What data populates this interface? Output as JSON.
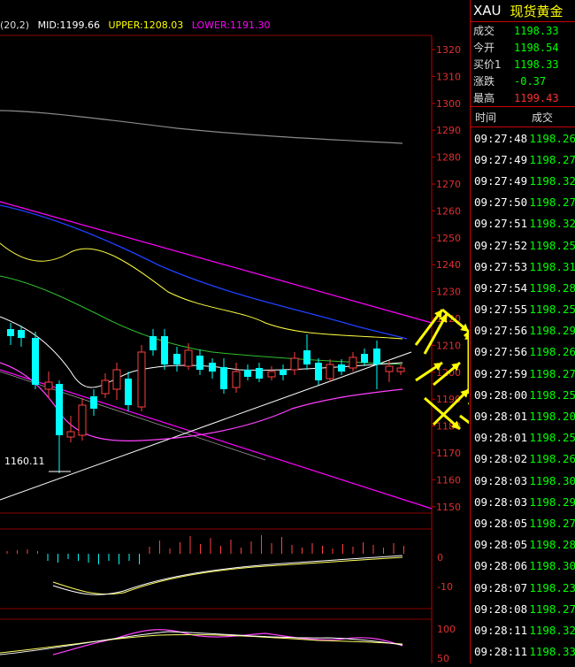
{
  "indicator": {
    "params": "(20,2)",
    "mid": "MID:1199.66",
    "upper": "UPPER:1208.03",
    "lower": "LOWER:1191.30",
    "colors": {
      "params": "#dddddd",
      "mid": "#ffffff",
      "upper": "#ffff00",
      "lower": "#ff00ff"
    }
  },
  "chart": {
    "price_axis": [
      "1320",
      "1310",
      "1300",
      "1290",
      "1280",
      "1270",
      "1260",
      "1250",
      "1240",
      "1230",
      "1220",
      "1210",
      "1200",
      "1190",
      "1180",
      "1170",
      "1160",
      "1150"
    ],
    "low_annotation": "1160.11",
    "macd_axis": [
      "0",
      "-10"
    ],
    "kdj_axis": [
      "100",
      "50"
    ]
  },
  "quote": {
    "symbol_code": "XAU",
    "symbol_name": "现货黄金",
    "fields": [
      {
        "label": "成交",
        "value": "1198.33",
        "color": "#00ff00"
      },
      {
        "label": "今开",
        "value": "1198.54",
        "color": "#00ff00"
      },
      {
        "label": "买价1",
        "value": "1198.33",
        "color": "#00ff00"
      },
      {
        "label": "涨跌",
        "value": "-0.37",
        "color": "#00ff00"
      },
      {
        "label": "最高",
        "value": "1199.43",
        "color": "#ff3030"
      }
    ],
    "ticks_header": {
      "time": "时间",
      "price": "成交"
    },
    "ticks": [
      {
        "t": "09:27:48",
        "p": "1198.26"
      },
      {
        "t": "09:27:49",
        "p": "1198.27"
      },
      {
        "t": "09:27:49",
        "p": "1198.32"
      },
      {
        "t": "09:27:50",
        "p": "1198.27"
      },
      {
        "t": "09:27:51",
        "p": "1198.32"
      },
      {
        "t": "09:27:52",
        "p": "1198.25"
      },
      {
        "t": "09:27:53",
        "p": "1198.31"
      },
      {
        "t": "09:27:54",
        "p": "1198.28"
      },
      {
        "t": "09:27:55",
        "p": "1198.25"
      },
      {
        "t": "09:27:56",
        "p": "1198.29"
      },
      {
        "t": "09:27:56",
        "p": "1198.26"
      },
      {
        "t": "09:27:59",
        "p": "1198.27"
      },
      {
        "t": "09:28:00",
        "p": "1198.25"
      },
      {
        "t": "09:28:01",
        "p": "1198.20"
      },
      {
        "t": "09:28:01",
        "p": "1198.25"
      },
      {
        "t": "09:28:02",
        "p": "1198.26"
      },
      {
        "t": "09:28:03",
        "p": "1198.30"
      },
      {
        "t": "09:28:03",
        "p": "1198.29"
      },
      {
        "t": "09:28:05",
        "p": "1198.27"
      },
      {
        "t": "09:28:05",
        "p": "1198.28"
      },
      {
        "t": "09:28:06",
        "p": "1198.30"
      },
      {
        "t": "09:28:07",
        "p": "1198.23"
      },
      {
        "t": "09:28:08",
        "p": "1198.27"
      },
      {
        "t": "09:28:11",
        "p": "1198.32"
      },
      {
        "t": "09:28:11",
        "p": "1198.33"
      }
    ]
  }
}
